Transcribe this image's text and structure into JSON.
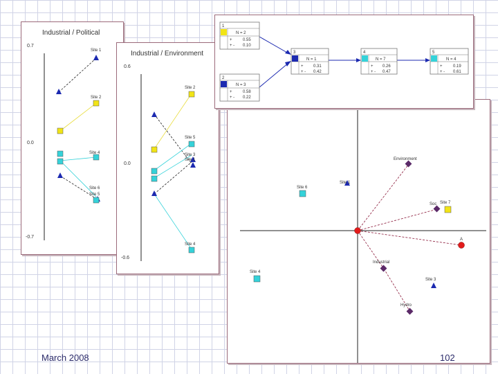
{
  "footer": {
    "date": "March 2008",
    "page": "102"
  },
  "colors": {
    "yellow": "#f1e416",
    "cyan": "#35d2d9",
    "navy": "#1c2ab0",
    "purple": "#5b2a68",
    "red": "#e21b1b",
    "border": "#9b6a7a"
  },
  "panel_political": {
    "title": "Industrial / Political",
    "ticks": {
      "top": "0.7",
      "mid": "0.0",
      "bottom": "-0.7"
    },
    "labels": {
      "site1": "Site 1",
      "site2": "Site 2",
      "site4": "Site 4",
      "site6": "Site 6",
      "site5": "Site 5"
    }
  },
  "panel_environment": {
    "title": "Industrial / Environment",
    "ticks": {
      "top": "0.6",
      "mid": "0.0",
      "bottom": "-0.6"
    },
    "labels": {
      "site2": "Site 2",
      "site5": "Site 5",
      "site3": "Site 3",
      "site1": "Site 1",
      "site4": "Site 4"
    }
  },
  "tree": {
    "nodes": [
      {
        "id": "1",
        "count": "N = 2",
        "r1": "0.55",
        "r2": "0.10"
      },
      {
        "id": "2",
        "count": "N = 3",
        "r1": "0.58",
        "r2": "0.22"
      },
      {
        "id": "3",
        "count": "N = 1",
        "r1": "0.31",
        "r2": "0.42"
      },
      {
        "id": "4",
        "count": "N = 7",
        "r1": "0.26",
        "r2": "0.47"
      },
      {
        "id": "5",
        "count": "N = 4",
        "r1": "0.19",
        "r2": "0.61"
      }
    ]
  },
  "biplot": {
    "labels": {
      "environment": "Environment",
      "site1": "Site 1",
      "site6": "Site 6",
      "site7": "Site 7",
      "soc": "Soc",
      "industrial": "Industrial",
      "site4": "Site 4",
      "site3": "Site 3",
      "hydro": "Hydro",
      "a": "A"
    }
  }
}
